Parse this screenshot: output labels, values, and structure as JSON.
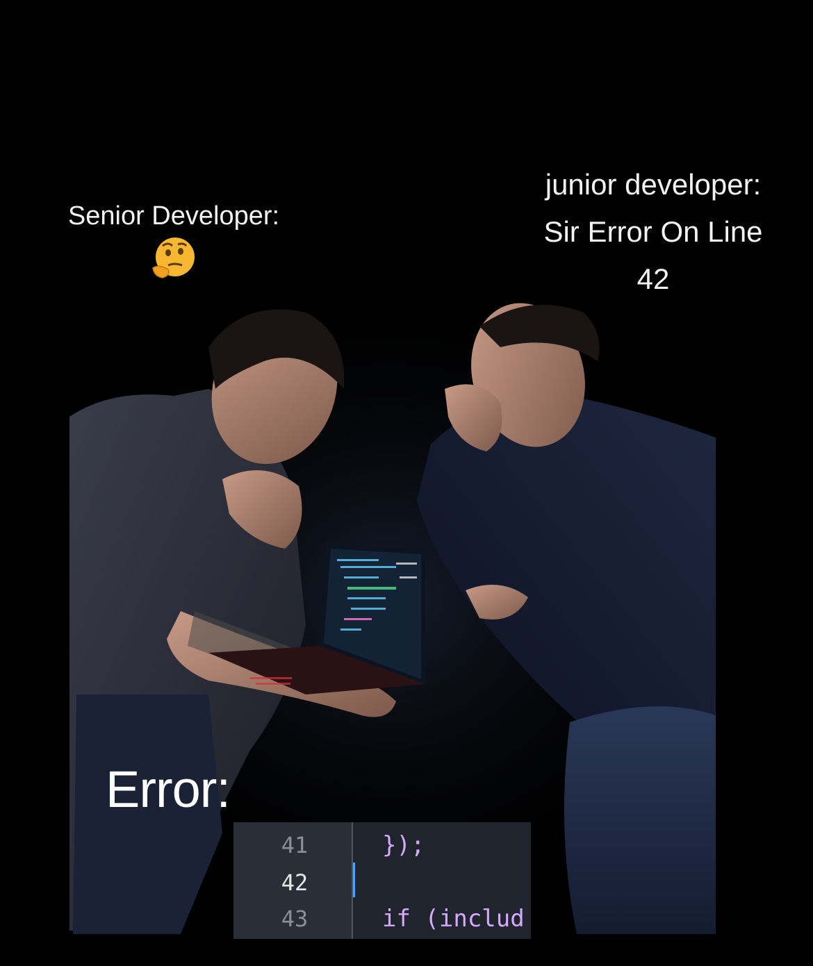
{
  "captions": {
    "senior": "Senior Developer:",
    "junior_line1": "junior developer:",
    "junior_line2": "Sir Error On Line",
    "junior_line3": "42",
    "error": "Error:"
  },
  "emoji": {
    "name": "thinking-face-icon",
    "color": "#f7b731"
  },
  "code": {
    "lines": [
      {
        "number": "41",
        "text": "});"
      },
      {
        "number": "42",
        "text": ""
      },
      {
        "number": "43",
        "text": "if (includ"
      }
    ],
    "active_line": "42",
    "colors": {
      "background": "#20242c",
      "gutter": "#2a2e36",
      "cursor": "#4aa3ff",
      "code": "#d7a8ff"
    }
  },
  "colors": {
    "background": "#000000",
    "caption": "#f2f2f2"
  }
}
